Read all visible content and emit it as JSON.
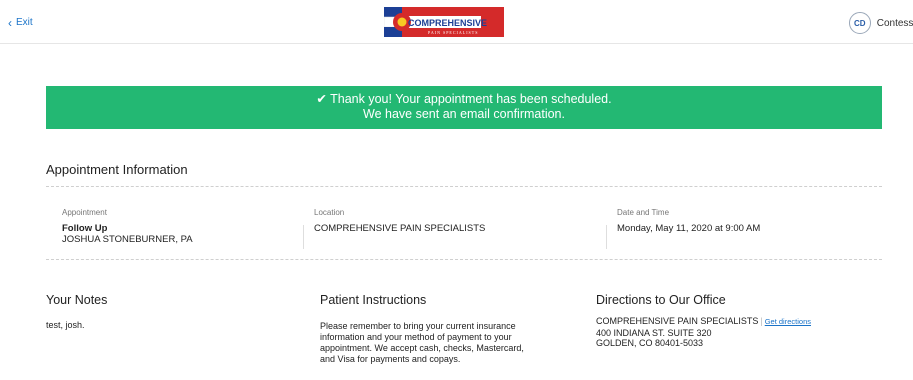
{
  "header": {
    "exit_label": "Exit",
    "logo_text": "COMPREHENSIVE",
    "logo_subtext": "PAIN SPECIALISTS",
    "user_initials": "CD",
    "user_name": "Contessa"
  },
  "banner": {
    "line1": "✔ Thank you! Your appointment has been scheduled.",
    "line2": "We have sent an email confirmation.",
    "color": "#23b873"
  },
  "appointment": {
    "title": "Appointment Information",
    "appointment_label": "Appointment",
    "appointment_type": "Follow Up",
    "provider": "JOSHUA STONEBURNER, PA",
    "location_label": "Location",
    "location": "COMPREHENSIVE PAIN SPECIALISTS",
    "datetime_label": "Date and Time",
    "datetime": "Monday, May 11, 2020 at 9:00 AM"
  },
  "notes": {
    "title": "Your Notes",
    "text": "test, josh."
  },
  "instructions": {
    "title": "Patient Instructions",
    "line1": "Please remember to bring your current insurance",
    "line2": "information and your method of payment to your",
    "line3": "appointment. We accept cash, checks, Mastercard,",
    "line4": "and Visa for payments and copays."
  },
  "directions": {
    "title": "Directions to Our Office",
    "office_name": "COMPREHENSIVE PAIN SPECIALISTS",
    "link_label": "Get directions",
    "street": "400 INDIANA ST. SUITE 320",
    "city": "GOLDEN, CO 80401-5033"
  }
}
